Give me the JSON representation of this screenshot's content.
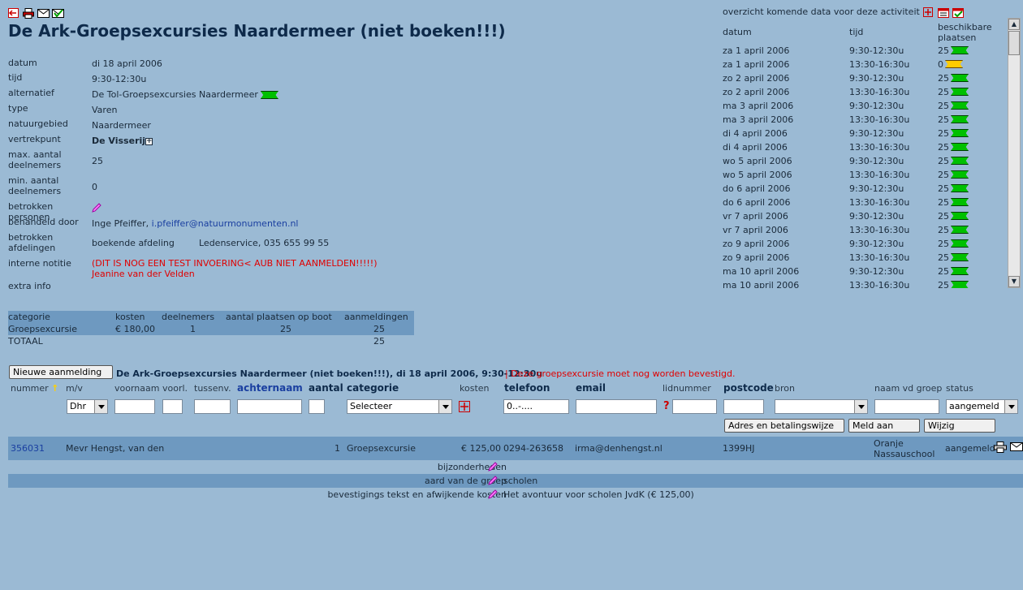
{
  "header": {
    "title": "De Ark-Groepsexcursies Naardermeer (niet boeken!!!)",
    "icons": [
      "back-icon",
      "print-icon",
      "mail-icon",
      "mail-check-icon"
    ]
  },
  "details": {
    "datum": {
      "label": "datum",
      "value": "di 18 april 2006"
    },
    "tijd": {
      "label": "tijd",
      "value": "9:30-12:30u"
    },
    "alternatief": {
      "label": "alternatief",
      "value": "De Tol-Groepsexcursies Naardermeer"
    },
    "type": {
      "label": "type",
      "value": "Varen"
    },
    "natuurgebied": {
      "label": "natuurgebied",
      "value": "Naardermeer"
    },
    "vertrekpunt": {
      "label": "vertrekpunt",
      "value": "De Visserij"
    },
    "max": {
      "label1": "max. aantal",
      "label2": "deelnemers",
      "value": "25"
    },
    "min": {
      "label1": "min. aantal",
      "label2": "deelnemers",
      "value": "0"
    },
    "betrokken_personen": {
      "label": "betrokken personen"
    },
    "behandeld_door": {
      "label": "behandeld door",
      "name": "Inge Pfeiffer,",
      "email": "i.pfeiffer@natuurmonumenten.nl"
    },
    "afdelingen": {
      "label1": "betrokken",
      "label2": "afdelingen",
      "value1": "boekende afdeling",
      "value2": "Ledenservice, 035 655 99 55"
    },
    "interne_notitie": {
      "label": "interne notitie",
      "line1": "(DIT IS NOG EEN TEST INVOERING< AUB NIET AANMELDEN!!!!!)",
      "line2": "Jeanine van der Velden"
    },
    "extra_info": {
      "label": "extra info"
    }
  },
  "overview": {
    "heading": "overzicht komende data voor deze activiteit",
    "col_datum": "datum",
    "col_tijd": "tijd",
    "col_plaatsen1": "beschikbare",
    "col_plaatsen2": "plaatsen",
    "rows": [
      {
        "datum": "za 1 april 2006",
        "tijd": "9:30-12:30u",
        "plaatsen": "25",
        "status": "green"
      },
      {
        "datum": "za 1 april 2006",
        "tijd": "13:30-16:30u",
        "plaatsen": "0",
        "status": "yellow"
      },
      {
        "datum": "zo 2 april 2006",
        "tijd": "9:30-12:30u",
        "plaatsen": "25",
        "status": "green"
      },
      {
        "datum": "zo 2 april 2006",
        "tijd": "13:30-16:30u",
        "plaatsen": "25",
        "status": "green"
      },
      {
        "datum": "ma 3 april 2006",
        "tijd": "9:30-12:30u",
        "plaatsen": "25",
        "status": "green"
      },
      {
        "datum": "ma 3 april 2006",
        "tijd": "13:30-16:30u",
        "plaatsen": "25",
        "status": "green"
      },
      {
        "datum": "di 4 april 2006",
        "tijd": "9:30-12:30u",
        "plaatsen": "25",
        "status": "green"
      },
      {
        "datum": "di 4 april 2006",
        "tijd": "13:30-16:30u",
        "plaatsen": "25",
        "status": "green"
      },
      {
        "datum": "wo 5 april 2006",
        "tijd": "9:30-12:30u",
        "plaatsen": "25",
        "status": "green"
      },
      {
        "datum": "wo 5 april 2006",
        "tijd": "13:30-16:30u",
        "plaatsen": "25",
        "status": "green"
      },
      {
        "datum": "do 6 april 2006",
        "tijd": "9:30-12:30u",
        "plaatsen": "25",
        "status": "green"
      },
      {
        "datum": "do 6 april 2006",
        "tijd": "13:30-16:30u",
        "plaatsen": "25",
        "status": "green"
      },
      {
        "datum": "vr 7 april 2006",
        "tijd": "9:30-12:30u",
        "plaatsen": "25",
        "status": "green"
      },
      {
        "datum": "vr 7 april 2006",
        "tijd": "13:30-16:30u",
        "plaatsen": "25",
        "status": "green"
      },
      {
        "datum": "zo 9 april 2006",
        "tijd": "9:30-12:30u",
        "plaatsen": "25",
        "status": "green"
      },
      {
        "datum": "zo 9 april 2006",
        "tijd": "13:30-16:30u",
        "plaatsen": "25",
        "status": "green"
      },
      {
        "datum": "ma 10 april 2006",
        "tijd": "9:30-12:30u",
        "plaatsen": "25",
        "status": "green"
      },
      {
        "datum": "ma 10 april 2006",
        "tijd": "13:30-16:30u",
        "plaatsen": "25",
        "status": "green"
      }
    ]
  },
  "summary": {
    "headers": [
      "categorie",
      "kosten",
      "deelnemers",
      "aantal plaatsen op boot",
      "aanmeldingen"
    ],
    "row": [
      "Groepsexcursie",
      "€ 180,00",
      "1",
      "25",
      "25"
    ],
    "total_label": "TOTAAL",
    "total_value": "25"
  },
  "registration": {
    "new_button": "Nieuwe aanmelding",
    "info_title": "De Ark-Groepsexcursies Naardermeer (niet boeken!!!), di 18 april 2006, 9:30-12:30u",
    "sep": "|",
    "warning": "| Deze groepsexcursie moet nog worden bevestigd.",
    "headers": {
      "nummer": "nummer",
      "mv": "m/v",
      "voornaam": "voornaam",
      "voorl": "voorl.",
      "tussenv": "tussenv.",
      "achternaam": "achternaam",
      "aantal": "aantal",
      "categorie": "categorie",
      "kosten": "kosten",
      "telefoon": "telefoon",
      "email": "email",
      "lidnummer": "lidnummer",
      "postcode": "postcode",
      "bron": "bron",
      "naam_groep": "naam vd groep",
      "status": "status"
    },
    "inputs": {
      "mv": "Dhr",
      "categorie": "Selecteer",
      "telefoon": "0..-....",
      "status": "aangemeld"
    },
    "buttons": {
      "adres": "Adres en betalingswijze",
      "meld": "Meld aan",
      "wijzig": "Wijzig"
    },
    "entry": {
      "nummer": "356031",
      "naam": "Mevr Hengst, van den",
      "aantal": "1",
      "categorie": "Groepsexcursie",
      "kosten": "€ 125,00",
      "telefoon": "0294-263658",
      "email": "irma@denhengst.nl",
      "postcode": "1399HJ",
      "groep1": "Oranje",
      "groep2": "Nassauschool",
      "status": "aangemeld"
    },
    "extras": [
      {
        "label": "bijzonderheden",
        "value": ""
      },
      {
        "label": "aard van de groep",
        "value": "scholen"
      },
      {
        "label": "bevestigings tekst en afwijkende kosten",
        "value": "Het avontuur voor scholen JvdK (€ 125,00)"
      }
    ]
  }
}
